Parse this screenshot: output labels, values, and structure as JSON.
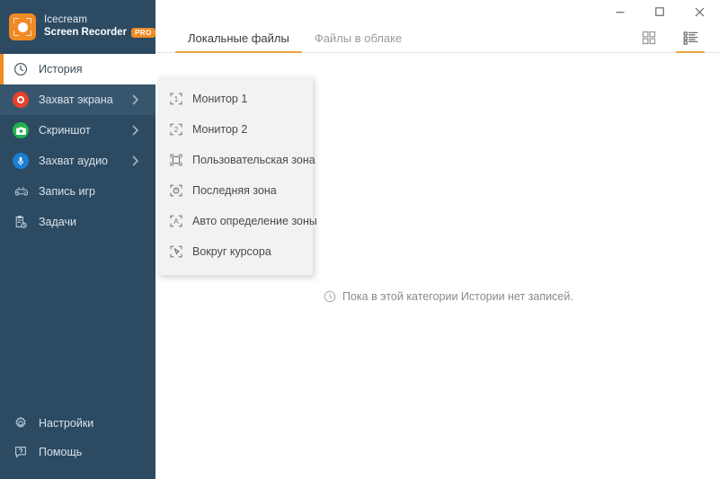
{
  "brand": {
    "line1": "Icecream",
    "line2": "Screen Recorder",
    "badge": "PRO",
    "logo_icon": "record-target-icon",
    "accent_color": "#f08a24"
  },
  "window": {
    "minimize_label": "Свернуть",
    "maximize_label": "Развернуть",
    "close_label": "Закрыть",
    "minimize_icon": "minimize-icon",
    "maximize_icon": "maximize-icon",
    "close_icon": "close-icon"
  },
  "sidebar": {
    "background_color": "#2c4a62",
    "items": [
      {
        "label": "История",
        "icon": "clock-icon",
        "active": true,
        "has_chevron": false,
        "hovered": false
      },
      {
        "label": "Захват экрана",
        "icon": "record-circle-icon",
        "active": false,
        "has_chevron": true,
        "hovered": true
      },
      {
        "label": "Скриншот",
        "icon": "camera-icon",
        "active": false,
        "has_chevron": true,
        "hovered": false
      },
      {
        "label": "Захват аудио",
        "icon": "microphone-icon",
        "active": false,
        "has_chevron": true,
        "hovered": false
      },
      {
        "label": "Запись игр",
        "icon": "gamepad-icon",
        "active": false,
        "has_chevron": false,
        "hovered": false
      },
      {
        "label": "Задачи",
        "icon": "tasks-clipboard-icon",
        "active": false,
        "has_chevron": false,
        "hovered": false
      }
    ],
    "bottom_items": [
      {
        "label": "Настройки",
        "icon": "gear-icon"
      },
      {
        "label": "Помощь",
        "icon": "help-question-icon"
      }
    ]
  },
  "tabs": [
    {
      "label": "Локальные файлы",
      "active": true
    },
    {
      "label": "Файлы в облаке",
      "active": false
    }
  ],
  "view_toggles": [
    {
      "name": "grid-view",
      "icon": "grid-view-icon",
      "active": false
    },
    {
      "name": "list-view",
      "icon": "list-view-icon",
      "active": true
    }
  ],
  "content": {
    "empty_message": "Пока в этой категории Истории нет записей.",
    "empty_icon": "clock-icon"
  },
  "dropdown": {
    "items": [
      {
        "label": "Монитор 1",
        "icon": "monitor-one-icon"
      },
      {
        "label": "Монитор 2",
        "icon": "monitor-two-icon"
      },
      {
        "label": "Пользовательская зона",
        "icon": "custom-area-icon"
      },
      {
        "label": "Последняя зона",
        "icon": "last-area-icon"
      },
      {
        "label": "Авто определение зоны",
        "icon": "auto-area-icon"
      },
      {
        "label": "Вокруг курсора",
        "icon": "around-cursor-icon"
      }
    ]
  }
}
